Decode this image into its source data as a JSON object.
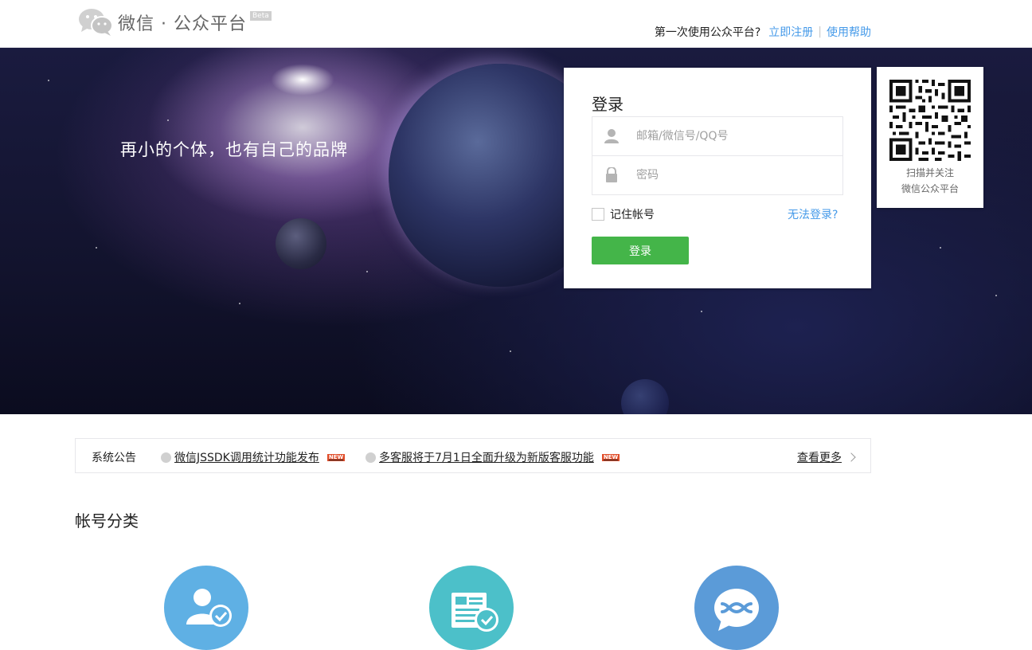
{
  "header": {
    "logo_text": "微信 · 公众平台",
    "beta_label": "Beta",
    "question": "第一次使用公众平台?",
    "register_link": "立即注册",
    "help_link": "使用帮助"
  },
  "banner": {
    "slogan": "再小的个体，也有自己的品牌"
  },
  "login": {
    "title": "登录",
    "username_placeholder": "邮箱/微信号/QQ号",
    "password_placeholder": "密码",
    "remember_label": "记住帐号",
    "forgot_link": "无法登录?",
    "submit_label": "登录"
  },
  "qr": {
    "caption_line1": "扫描并关注",
    "caption_line2": "微信公众平台"
  },
  "notice": {
    "label": "系统公告",
    "items": [
      {
        "text": "微信JSSDK调用统计功能发布",
        "tag": "NEW"
      },
      {
        "text": "多客服将于7月1日全面升级为新版客服功能",
        "tag": "NEW"
      }
    ],
    "more_label": "查看更多"
  },
  "categories": {
    "title": "帐号分类",
    "icons": [
      {
        "icon": "service-account-icon",
        "color": "#5fb0e4"
      },
      {
        "icon": "subscription-account-icon",
        "color": "#4cc0c9"
      },
      {
        "icon": "enterprise-account-icon",
        "color": "#5b9bd8"
      }
    ]
  },
  "colors": {
    "accent_link": "#459ae9",
    "login_button": "#44b549"
  }
}
